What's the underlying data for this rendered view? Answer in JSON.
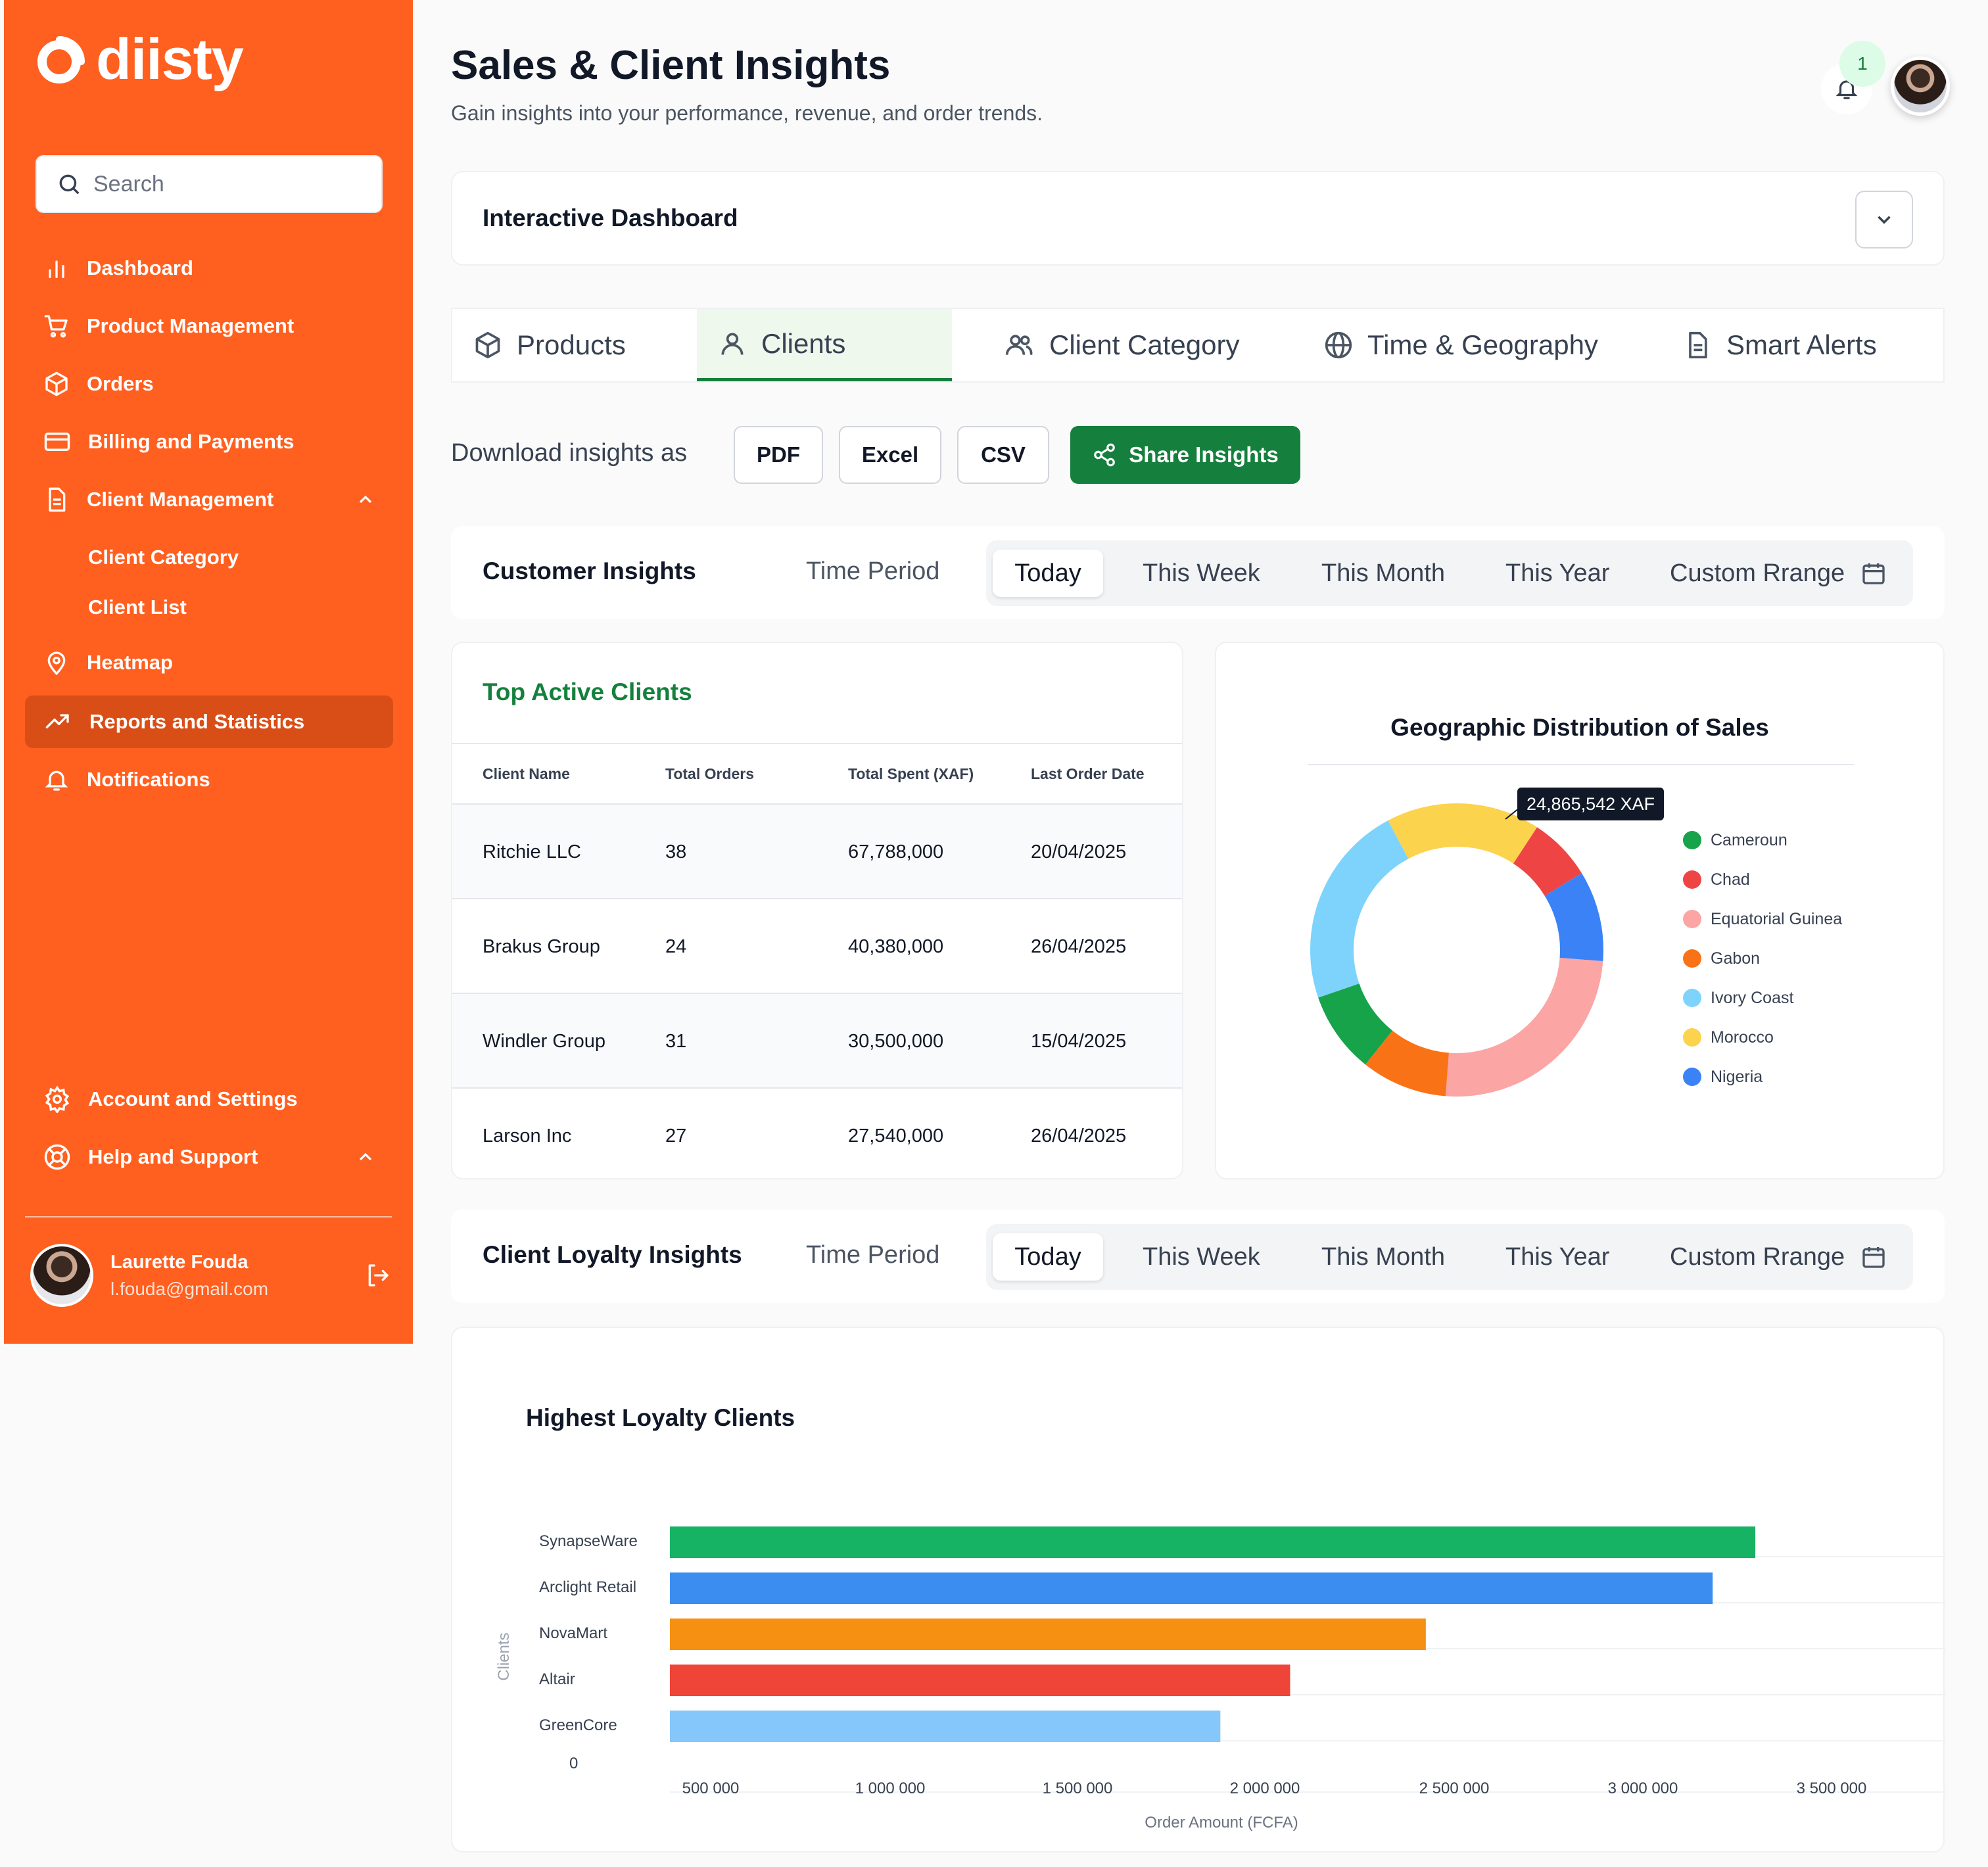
{
  "brand": {
    "name": "diisty",
    "primary": "#FF5F1F",
    "accent": "#15803D"
  },
  "sidebar": {
    "search_placeholder": "Search",
    "items": [
      {
        "label": "Dashboard",
        "icon": "bar-chart-icon"
      },
      {
        "label": "Product Management",
        "icon": "cart-icon"
      },
      {
        "label": "Orders",
        "icon": "box-icon"
      },
      {
        "label": "Billing and Payments",
        "icon": "credit-card-icon"
      },
      {
        "label": "Client Management",
        "icon": "document-icon",
        "expanded": true
      },
      {
        "label": "Heatmap",
        "icon": "map-pin-icon"
      },
      {
        "label": "Reports and Statistics",
        "icon": "trend-icon",
        "active": true
      },
      {
        "label": "Notifications",
        "icon": "bell-icon"
      }
    ],
    "sub_items": [
      "Client Category",
      "Client List"
    ],
    "bottom": [
      {
        "label": "Account and Settings",
        "icon": "gear-icon"
      },
      {
        "label": "Help and Support",
        "icon": "lifebuoy-icon"
      }
    ],
    "user": {
      "name": "Laurette Fouda",
      "email": "l.fouda@gmail.com"
    }
  },
  "header": {
    "title": "Sales & Client Insights",
    "subtitle": "Gain insights into your performance, revenue, and order trends.",
    "notification_count": "1"
  },
  "dashboard": {
    "title": "Interactive Dashboard"
  },
  "tabs": [
    {
      "label": "Products",
      "icon": "box-icon"
    },
    {
      "label": "Clients",
      "icon": "user-icon",
      "active": true
    },
    {
      "label": "Client Category",
      "icon": "users-icon"
    },
    {
      "label": "Time & Geography",
      "icon": "globe-icon"
    },
    {
      "label": "Smart Alerts",
      "icon": "document-icon"
    }
  ],
  "download": {
    "label": "Download insights as",
    "buttons": [
      "PDF",
      "Excel",
      "CSV"
    ],
    "share": "Share Insights"
  },
  "customer_insights": {
    "title": "Customer Insights",
    "period_label": "Time Period",
    "options": [
      "Today",
      "This Week",
      "This Month",
      "This Year",
      "Custom Rrange"
    ],
    "selected": "Today"
  },
  "top_clients": {
    "title": "Top Active Clients",
    "columns": [
      "Client Name",
      "Total Orders",
      "Total Spent (XAF)",
      "Last Order Date"
    ],
    "rows": [
      [
        "Ritchie LLC",
        "38",
        "67,788,000",
        "20/04/2025"
      ],
      [
        "Brakus Group",
        "24",
        "40,380,000",
        "26/04/2025"
      ],
      [
        "Windler Group",
        "31",
        "30,500,000",
        "15/04/2025"
      ],
      [
        "Larson Inc",
        "27",
        "27,540,000",
        "26/04/2025"
      ]
    ]
  },
  "loyalty_insights": {
    "title": "Client Loyalty Insights",
    "period_label": "Time Period",
    "options": [
      "Today",
      "This Week",
      "This Month",
      "This Year",
      "Custom Rrange"
    ],
    "selected": "Today"
  },
  "chart_data": [
    {
      "type": "pie",
      "title": "Geographic Distribution of Sales",
      "donut": true,
      "tooltip": "24,865,542 XAF",
      "legend_position": "right",
      "slices": [
        {
          "name": "Cameroun",
          "value": 9,
          "color": "#16A34A"
        },
        {
          "name": "Chad",
          "value": 7,
          "color": "#EF4444"
        },
        {
          "name": "Equatorial Guinea",
          "value": 25,
          "color": "#FCA5A5"
        },
        {
          "name": "Gabon",
          "value": 9.5,
          "color": "#F97316"
        },
        {
          "name": "Ivory Coast",
          "value": 22.5,
          "color": "#7DD3FC"
        },
        {
          "name": "Morocco",
          "value": 17,
          "color": "#FCD34D"
        },
        {
          "name": "Nigeria",
          "value": 10,
          "color": "#3B82F6"
        }
      ]
    },
    {
      "type": "bar",
      "orientation": "horizontal",
      "title": "Highest Loyalty Clients",
      "xlabel": "Order Amount (FCFA)",
      "ylabel": "Clients",
      "categories": [
        "SynapseWare",
        "Arclight Retail",
        "NovaMart",
        "Altair",
        "GreenCore"
      ],
      "values": [
        3300000,
        3190000,
        2450000,
        2100000,
        1920000
      ],
      "colors": [
        "#16B364",
        "#3B8EF0",
        "#F59012",
        "#EF4438",
        "#85C7FB"
      ],
      "xticks": [
        "500 000",
        "1 000 000",
        "1 500 000",
        "2 000 000",
        "2 500 000",
        "3 000 000",
        "3 500 000"
      ],
      "y_origin_label": "0",
      "xlim": [
        500000,
        3500000
      ]
    }
  ]
}
